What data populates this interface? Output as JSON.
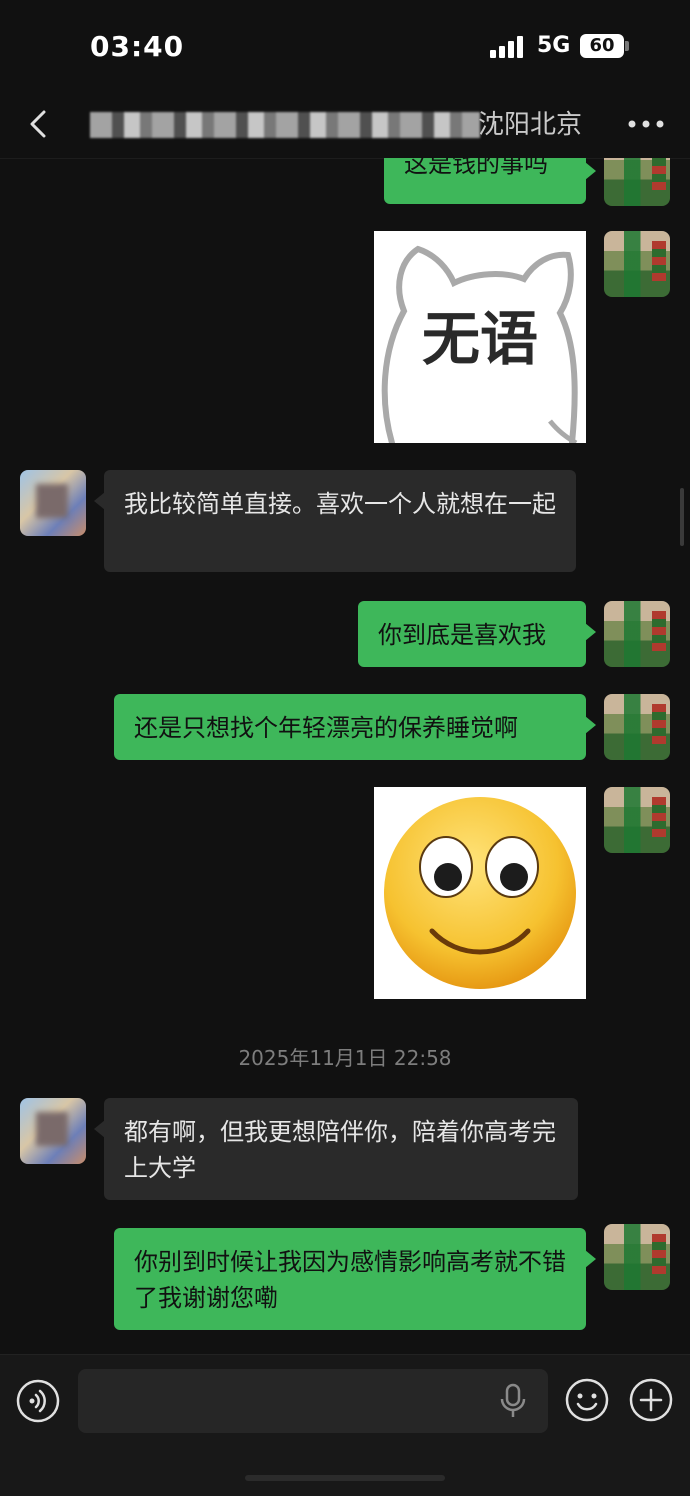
{
  "status_bar": {
    "time": "03:40",
    "network": "5G",
    "battery": "60"
  },
  "header": {
    "title": "沈阳北京",
    "back_icon": "chevron-left-icon",
    "more_icon": "more-dots-icon"
  },
  "messages": [
    {
      "side": "right",
      "type": "text",
      "text": "这是钱的事吗"
    },
    {
      "side": "right",
      "type": "sticker",
      "sticker_text": "无语"
    },
    {
      "side": "left",
      "type": "text",
      "text": "我比较简单直接。喜欢一个人就想在一起"
    },
    {
      "side": "right",
      "type": "text",
      "text": "你到底是喜欢我"
    },
    {
      "side": "right",
      "type": "text",
      "text": "还是只想找个年轻漂亮的保养睡觉啊"
    },
    {
      "side": "right",
      "type": "sticker",
      "sticker_icon": "smiley-emoji-icon"
    },
    {
      "side": "left",
      "type": "text",
      "text": "都有啊，但我更想陪伴你，陪着你高考完上大学"
    },
    {
      "side": "right",
      "type": "text",
      "text": "你别到时候让我因为感情影响高考就不错了我谢谢您嘞"
    }
  ],
  "timestamp": "2025年11月1日 22:58",
  "input_bar": {
    "value": "",
    "voice_icon": "voice-icon",
    "mic_icon": "microphone-icon",
    "emoji_icon": "emoji-icon",
    "plus_icon": "plus-icon"
  },
  "colors": {
    "background": "#111111",
    "my_bubble": "#3eb75a",
    "their_bubble": "#2a2a2a"
  }
}
